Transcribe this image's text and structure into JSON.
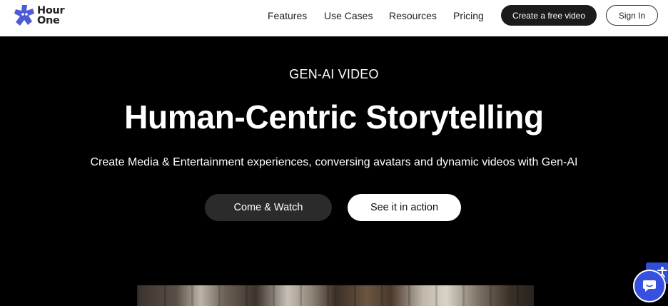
{
  "brand": {
    "line1": "Hour",
    "line2": "One",
    "accent": "#4f5bd5"
  },
  "nav": {
    "features": "Features",
    "use_cases": "Use Cases",
    "resources": "Resources",
    "pricing": "Pricing",
    "create_cta": "Create a free video",
    "sign_in": "Sign In"
  },
  "hero": {
    "eyebrow": "GEN-AI VIDEO",
    "title": "Human-Centric Storytelling",
    "subtitle": "Create Media & Entertainment experiences, conversing avatars and dynamic videos with Gen-AI",
    "primary_button": "Come & Watch",
    "secondary_button": "See it in action"
  },
  "widgets": {
    "accessibility_icon": "accessibility-icon",
    "chat_icon": "chat-icon",
    "chat_color": "#3650e0"
  }
}
